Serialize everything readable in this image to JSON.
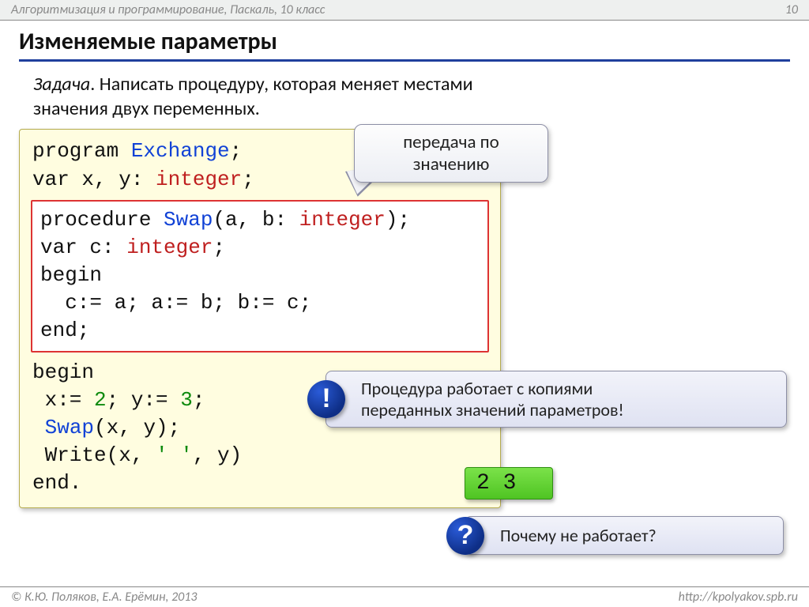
{
  "header": {
    "left": "Алгоритмизация и программирование, Паскаль, 10 класс",
    "page": "10"
  },
  "title": "Изменяемые параметры",
  "task": {
    "label": "Задача",
    "body1": ". Написать процедуру, которая меняет местами",
    "body2": "значения двух переменных."
  },
  "bubble": {
    "line1": "передача по",
    "line2": "значению"
  },
  "code": {
    "l1a": "program ",
    "l1b": "Exchange",
    "l1c": ";",
    "l2a": "var x, y: ",
    "l2b": "integer",
    "l2c": ";",
    "p1a": "procedure ",
    "p1b": "Swap",
    "p1c": "(a, b: ",
    "p1d": "integer",
    "p1e": ");",
    "p2a": "var c: ",
    "p2b": "integer",
    "p2c": ";",
    "p3": "begin",
    "p4": "  c:= a; a:= b; b:= c;",
    "p5": "end;",
    "b1": "begin",
    "b2a": " x:= ",
    "b2b": "2",
    "b2c": "; y:= ",
    "b2d": "3",
    "b2e": ";",
    "b3a": " ",
    "b3b": "Swap",
    "b3c": "(x, y);",
    "b4a": " Write(x, ",
    "b4b": "' '",
    "b4c": ", y)",
    "b5": "end."
  },
  "note_excl": {
    "badge": "!",
    "line1": "Процедура работает с копиями",
    "line2": "переданных значений параметров!"
  },
  "output": "2 3",
  "note_q": {
    "badge": "?",
    "text": "Почему не работает?"
  },
  "footer": {
    "left": "© К.Ю. Поляков, Е.А. Ерёмин, 2013",
    "right": "http://kpolyakov.spb.ru"
  }
}
